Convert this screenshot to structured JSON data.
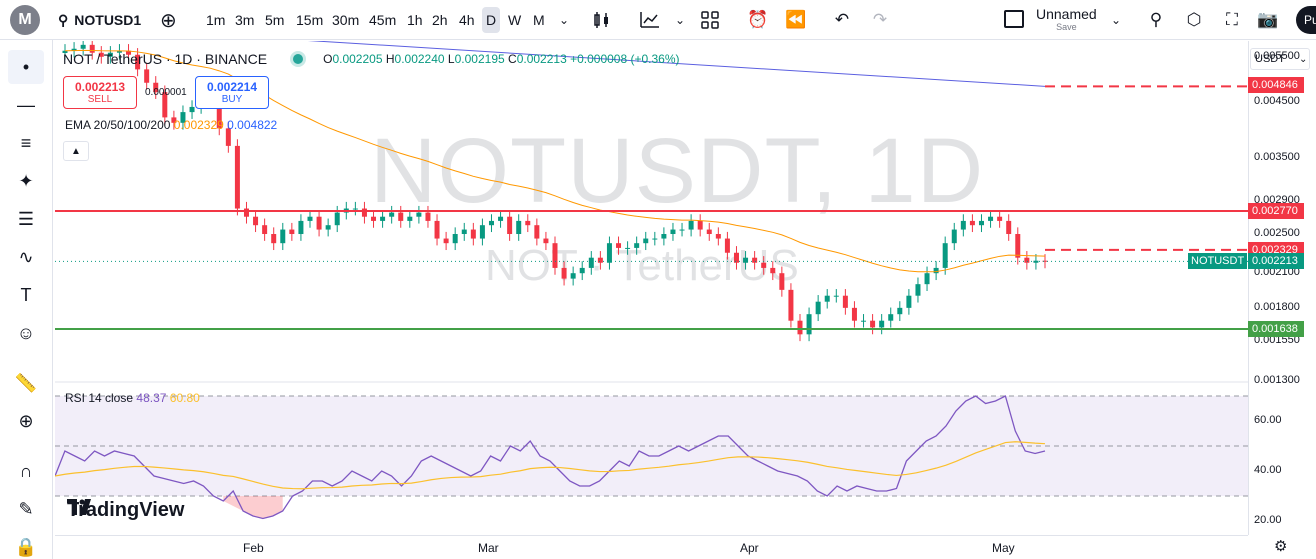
{
  "toolbar": {
    "logo_letter": "M",
    "symbol": "NOTUSD1",
    "intervals": [
      "1m",
      "3m",
      "5m",
      "15m",
      "30m",
      "45m",
      "1h",
      "2h",
      "4h",
      "D",
      "W",
      "M"
    ],
    "active_interval": "D",
    "layout_name": "Unnamed",
    "save_label": "Save",
    "publish_label": "Pu"
  },
  "legend": {
    "title": "NOT / TetherUS · 1D · BINANCE",
    "o_label": "O",
    "o": "0.002205",
    "h_label": "H",
    "h": "0.002240",
    "l_label": "L",
    "l": "0.002195",
    "c_label": "C",
    "c": "0.002213",
    "change": "+0.000008 (+0.36%)",
    "sell_price": "0.002213",
    "sell_label": "SELL",
    "buy_price": "0.002214",
    "buy_label": "BUY",
    "spread": "0.000001",
    "ema_label": "EMA 20/50/100/200",
    "ema_v1": "0.002329",
    "ema_v2": "0.004822"
  },
  "watermark": {
    "main": "NOTUSDT, 1D",
    "sub": "NOT · TetherUS"
  },
  "rsi": {
    "label": "RSI 14 close",
    "value": "48.37",
    "ma": "60.80"
  },
  "brand": "TradingView",
  "price_axis": {
    "currency": "USDT",
    "ticks": [
      {
        "label": "0.005500",
        "price": 0.0055
      },
      {
        "label": "0.004500",
        "price": 0.0045
      },
      {
        "label": "0.003500",
        "price": 0.0035
      },
      {
        "label": "0.002900",
        "price": 0.0029
      },
      {
        "label": "0.002500",
        "price": 0.0025
      },
      {
        "label": "0.002100",
        "price": 0.0021
      },
      {
        "label": "0.001800",
        "price": 0.0018
      },
      {
        "label": "0.001550",
        "price": 0.00155
      },
      {
        "label": "0.001300",
        "price": 0.0013
      }
    ],
    "price_labels": [
      {
        "label": "0.004846",
        "price": 0.004846,
        "color": "#f23645"
      },
      {
        "label": "0.002770",
        "price": 0.00277,
        "color": "#f23645"
      },
      {
        "label": "0.002329",
        "price": 0.002329,
        "color": "#f23645"
      },
      {
        "label": "0.002213",
        "price": 0.002213,
        "color": "#089981"
      },
      {
        "label": "0.001638",
        "price": 0.001638,
        "color": "#43a047"
      }
    ],
    "symbol_tag": "NOTUSDT",
    "rsi_ticks": [
      "60.00",
      "40.00",
      "20.00"
    ]
  },
  "time_axis": [
    "Feb",
    "Mar",
    "Apr",
    "May"
  ],
  "colors": {
    "up": "#089981",
    "down": "#f23645",
    "resistance": "#f23645",
    "support": "#43a047",
    "ema_fast": "#ff9800",
    "ema_slow": "#5b5fe0",
    "rsi": "#7e57c2",
    "rsi_ma": "#fbc02d"
  },
  "chart_data": {
    "type": "candlestick",
    "series_closes": [
      0.00565,
      0.0057,
      0.0058,
      0.0056,
      0.0055,
      0.0056,
      0.00565,
      0.00555,
      0.0052,
      0.0049,
      0.0047,
      0.0042,
      0.0041,
      0.0043,
      0.0044,
      0.0046,
      0.0045,
      0.004,
      0.0037,
      0.0028,
      0.0027,
      0.0026,
      0.0025,
      0.0024,
      0.00255,
      0.0025,
      0.00265,
      0.0027,
      0.00255,
      0.0026,
      0.00275,
      0.0028,
      0.0028,
      0.0027,
      0.00265,
      0.0027,
      0.00275,
      0.00265,
      0.0027,
      0.00275,
      0.00265,
      0.00245,
      0.0024,
      0.0025,
      0.00255,
      0.00245,
      0.0026,
      0.00265,
      0.0027,
      0.0025,
      0.00265,
      0.0026,
      0.00245,
      0.0024,
      0.00215,
      0.00205,
      0.0021,
      0.00215,
      0.00225,
      0.0022,
      0.0024,
      0.00235,
      0.00235,
      0.0024,
      0.00245,
      0.00245,
      0.0025,
      0.00255,
      0.00255,
      0.00265,
      0.00255,
      0.0025,
      0.00245,
      0.0023,
      0.0022,
      0.00225,
      0.0022,
      0.00215,
      0.0021,
      0.00195,
      0.0017,
      0.0016,
      0.00175,
      0.00185,
      0.0019,
      0.0019,
      0.0018,
      0.0017,
      0.0017,
      0.00165,
      0.0017,
      0.00175,
      0.0018,
      0.0019,
      0.002,
      0.0021,
      0.00215,
      0.0024,
      0.00255,
      0.00265,
      0.0026,
      0.00265,
      0.0027,
      0.00265,
      0.0025,
      0.00225,
      0.0022,
      0.00222,
      0.002213
    ],
    "resistance": 0.00277,
    "support": 0.001638,
    "ema_fast_last": 0.002329,
    "ema_slow_last": 0.004822,
    "rsi_values": [
      38,
      48,
      46,
      44,
      48,
      46,
      48,
      47,
      46,
      42,
      38,
      37,
      36,
      35,
      36,
      34,
      30,
      28,
      32,
      24,
      22,
      21,
      22,
      24,
      30,
      32,
      36,
      36,
      34,
      36,
      40,
      38,
      36,
      40,
      38,
      34,
      38,
      44,
      46,
      44,
      42,
      40,
      38,
      40,
      46,
      44,
      50,
      48,
      52,
      46,
      44,
      40,
      36,
      34,
      34,
      36,
      40,
      44,
      42,
      48,
      46,
      46,
      48,
      50,
      48,
      50,
      52,
      54,
      54,
      50,
      46,
      44,
      42,
      40,
      39,
      38,
      36,
      32,
      30,
      34,
      32,
      34,
      33,
      32,
      32,
      33,
      44,
      48,
      52,
      54,
      58,
      64,
      68,
      70,
      67,
      68,
      70,
      56,
      48,
      47,
      48
    ],
    "rsi_ylim": [
      20,
      70
    ],
    "rsi_bands": [
      70,
      50,
      30
    ]
  }
}
